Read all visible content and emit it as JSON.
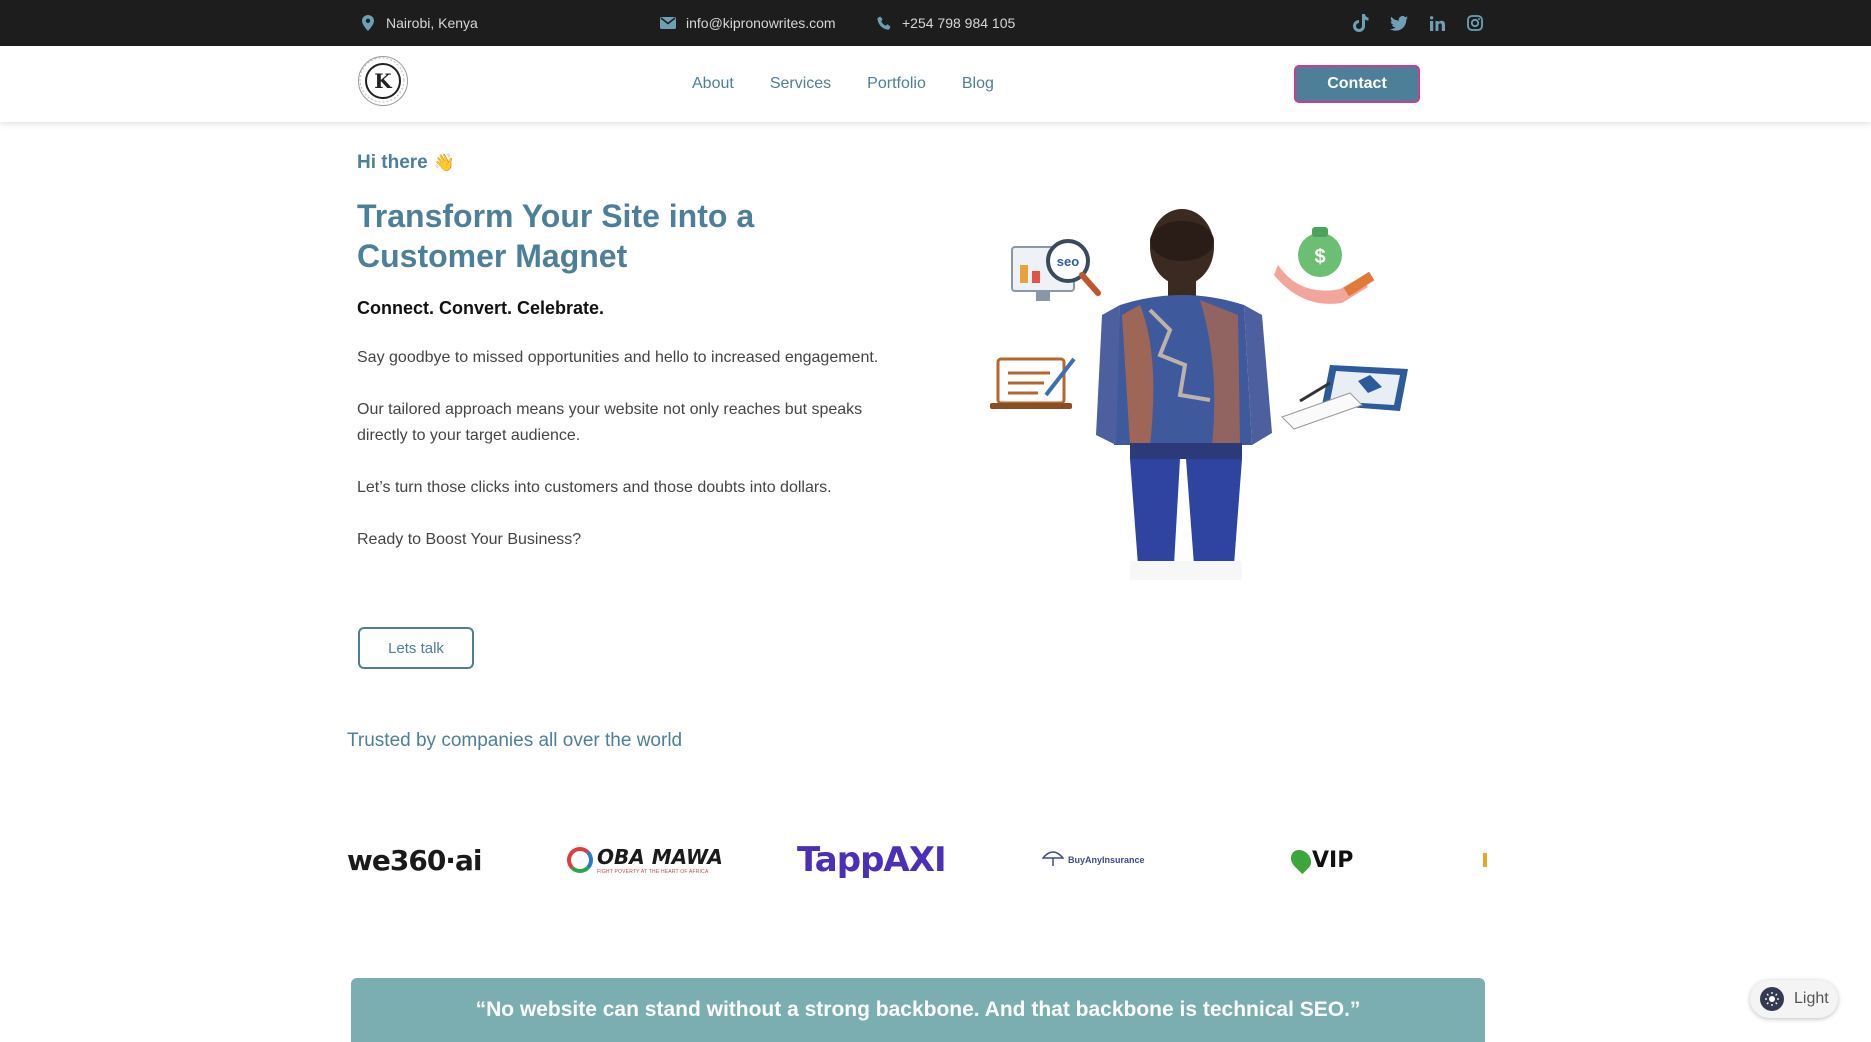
{
  "topbar": {
    "location": "Nairobi, Kenya",
    "email": "info@kipronowrites.com",
    "phone": "+254 798 984 105",
    "social_icons": [
      "tiktok-icon",
      "twitter-icon",
      "linkedin-icon",
      "instagram-icon"
    ]
  },
  "header": {
    "logo_letter": "K",
    "logo_ring_text": "KIPRONO WRITES",
    "nav": [
      "About",
      "Services",
      "Portfolio",
      "Blog"
    ],
    "contact_label": "Contact"
  },
  "hero": {
    "greeting": "Hi there",
    "greeting_emoji": "👋",
    "headline": "Transform Your Site into a Customer Magnet",
    "tagline": "Connect. Convert. Celebrate.",
    "paragraphs": [
      "Say goodbye to missed opportunities and hello to increased engagement.",
      "Our tailored approach means your website not only reaches but speaks directly to your target audience.",
      "Let’s turn those clicks into customers and those doubts into dollars.",
      "Ready to Boost Your Business?"
    ],
    "cta_label": "Lets talk",
    "art_labels": {
      "seo": "seo"
    }
  },
  "trusted": {
    "heading": "Trusted by companies all over the world",
    "logos": [
      "we360·ai",
      "OBA MAWA",
      "TappAXI",
      "BuyAnyInsurance",
      "VIP"
    ],
    "logo_taglines": {
      "oba_mawa": "FIGHT POVERTY AT THE HEART OF AFRICA"
    }
  },
  "quote": {
    "text": "“No website can stand without a strong backbone. And that backbone is technical SEO.”"
  },
  "theme_toggle": {
    "label": "Light"
  },
  "colors": {
    "accent": "#4d7f99",
    "topbar_bg": "#1d1d1d",
    "contact_border": "#c93c8f",
    "quote_band": "#7aaeb0"
  }
}
